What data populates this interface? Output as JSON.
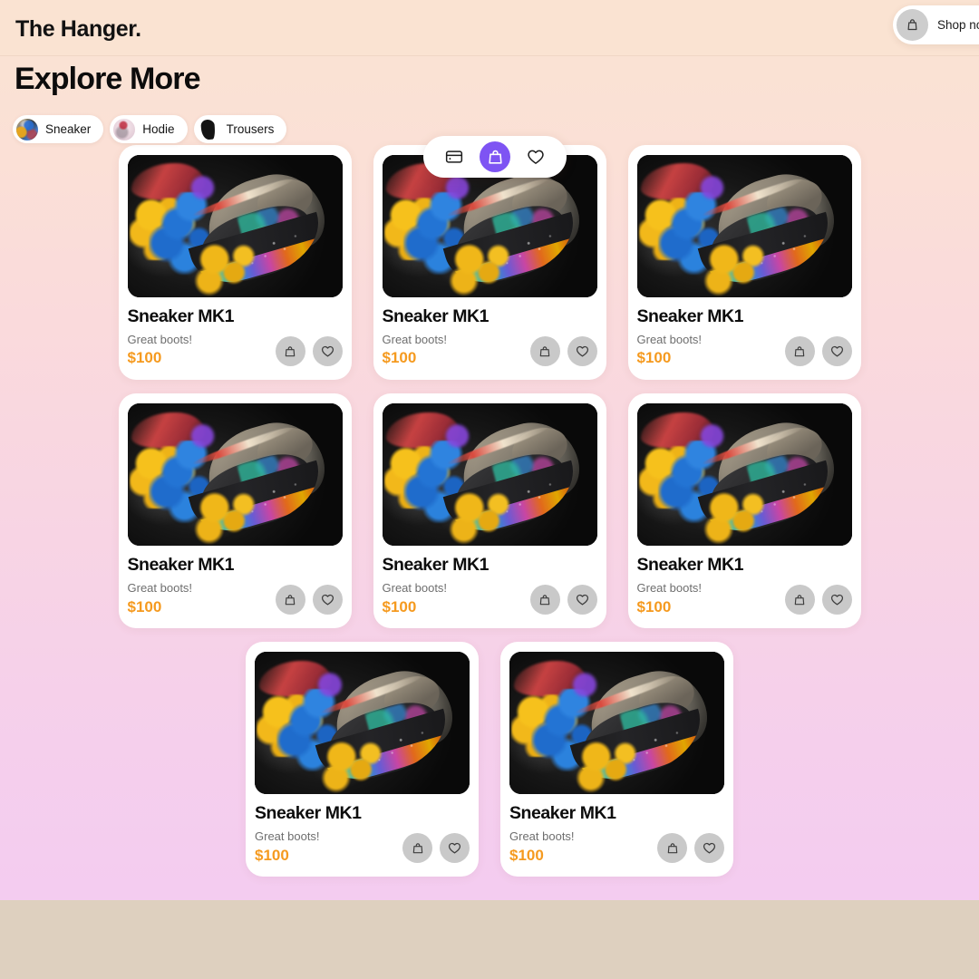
{
  "header": {
    "brand": "The Hanger.",
    "shop_button_label": "Shop now",
    "shop_button_icon": "shopping-bag-icon",
    "background_color": "#FAE3D2"
  },
  "page": {
    "section_title": "Explore More",
    "background_gradient_from": "#FAE4D3",
    "background_gradient_to": "#F3CBF2",
    "footer_color": "#DED0BF"
  },
  "categories": [
    {
      "label": "Sneaker",
      "thumb": "sneaker-thumb",
      "selected": true
    },
    {
      "label": "Hodie",
      "thumb": "hodie-thumb",
      "selected": false
    },
    {
      "label": "Trousers",
      "thumb": "trousers-thumb",
      "selected": false
    }
  ],
  "floating_toolbar": {
    "items": [
      {
        "icon": "credit-card-icon",
        "active": false
      },
      {
        "icon": "shopping-bag-icon",
        "active": true
      },
      {
        "icon": "heart-icon",
        "active": false
      }
    ],
    "active_color": "#7E54F3"
  },
  "products": [
    {
      "title": "Sneaker MK1",
      "description": "Great boots!",
      "price": "$100",
      "image": "sneaker-splash-photo"
    },
    {
      "title": "Sneaker MK1",
      "description": "Great boots!",
      "price": "$100",
      "image": "sneaker-splash-photo"
    },
    {
      "title": "Sneaker MK1",
      "description": "Great boots!",
      "price": "$100",
      "image": "sneaker-splash-photo"
    },
    {
      "title": "Sneaker MK1",
      "description": "Great boots!",
      "price": "$100",
      "image": "sneaker-splash-photo"
    },
    {
      "title": "Sneaker MK1",
      "description": "Great boots!",
      "price": "$100",
      "image": "sneaker-splash-photo"
    },
    {
      "title": "Sneaker MK1",
      "description": "Great boots!",
      "price": "$100",
      "image": "sneaker-splash-photo"
    },
    {
      "title": "Sneaker MK1",
      "description": "Great boots!",
      "price": "$100",
      "image": "sneaker-splash-photo"
    },
    {
      "title": "Sneaker MK1",
      "description": "Great boots!",
      "price": "$100",
      "image": "sneaker-splash-photo"
    }
  ],
  "card_actions": {
    "add_to_cart_icon": "shopping-bag-icon",
    "favorite_icon": "heart-icon",
    "button_color": "#C9C9C9"
  },
  "price_color": "#F59A1F"
}
